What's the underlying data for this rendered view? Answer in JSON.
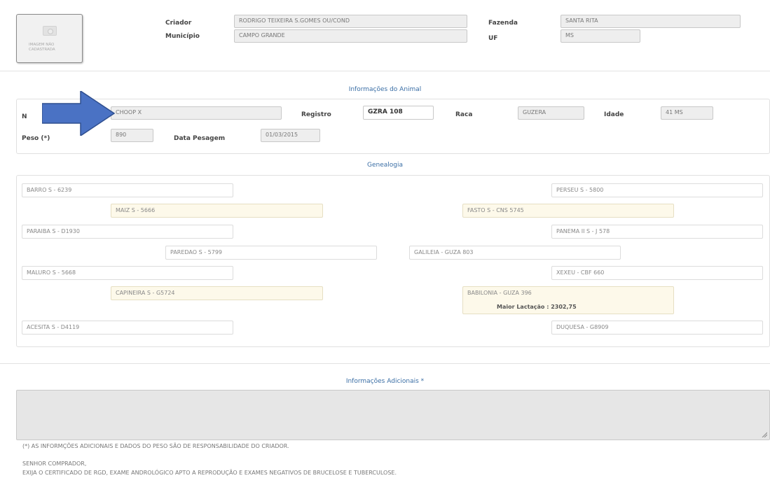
{
  "header": {
    "photo_caption": "IMAGEM NÃO CADASTRADA",
    "criador_label": "Criador",
    "criador_value": "RODRIGO TEIXEIRA S.GOMES OU/COND",
    "municipio_label": "Município",
    "municipio_value": "CAMPO GRANDE",
    "fazenda_label": "Fazenda",
    "fazenda_value": "SANTA RITA",
    "uf_label": "UF",
    "uf_value": "MS"
  },
  "animal": {
    "section_title": "Informações do Animal",
    "nome_label_partial": "N",
    "nome_value": "CHOOP X",
    "registro_label": "Registro",
    "registro_value": "GZRA 108",
    "raca_label": "Raca",
    "raca_value": "GUZERA",
    "idade_label": "Idade",
    "idade_value": "41 MS",
    "peso_label": "Peso (*)",
    "peso_value": "890",
    "data_pesagem_label": "Data Pesagem",
    "data_pesagem_value": "01/03/2015"
  },
  "genealogy": {
    "section_title": "Genealogia",
    "left": {
      "ggf1": "BARRO S - 6239",
      "gf1": "MAIZ S - 5666",
      "ggm1": "PARAIBA S - D1930",
      "sire": "PAREDAO S - 5799",
      "ggf2": "MALURO S - 5668",
      "gm1": "CAPINEIRA S - G5724",
      "ggm2": "ACESITA S - D4119"
    },
    "right": {
      "ggf3": "PERSEU S - 5800",
      "gf2": "FASTO S - CNS 5745",
      "ggm3": "PANEMA II S - J 578",
      "dam": "GALILEIA - GUZA 803",
      "ggf4": "XEXEU - CBF 660",
      "gm2": "BABILONIA - GUZA 396",
      "gm2_extra": "Maior Lactação : 2302,75",
      "ggm4": "DUQUESA - G8909"
    }
  },
  "additional": {
    "section_title": "Informações Adicionais *",
    "textarea_value": ""
  },
  "notes": {
    "disclaimer": "(*) AS INFORMÇÕES ADICIONAIS E DADOS DO PESO SÃO DE RESPONSABILIDADE DO CRIADOR.",
    "buyer_greeting": "SENHOR COMPRADOR,",
    "buyer_instructions": "EXIJA O CERTIFICADO DE RGD, EXAME ANDROLÓGICO APTO A REPRODUÇÃO E EXAMES NEGATIVOS DE BRUCELOSE E TUBERCULOSE."
  },
  "colors": {
    "accent": "#3a6ea5",
    "arrow_fill": "#4a72c4",
    "cream_field": "#fdf9ea"
  },
  "icons": [
    "camera-placeholder-icon",
    "right-arrow-annotation",
    "resize-grip-icon"
  ]
}
